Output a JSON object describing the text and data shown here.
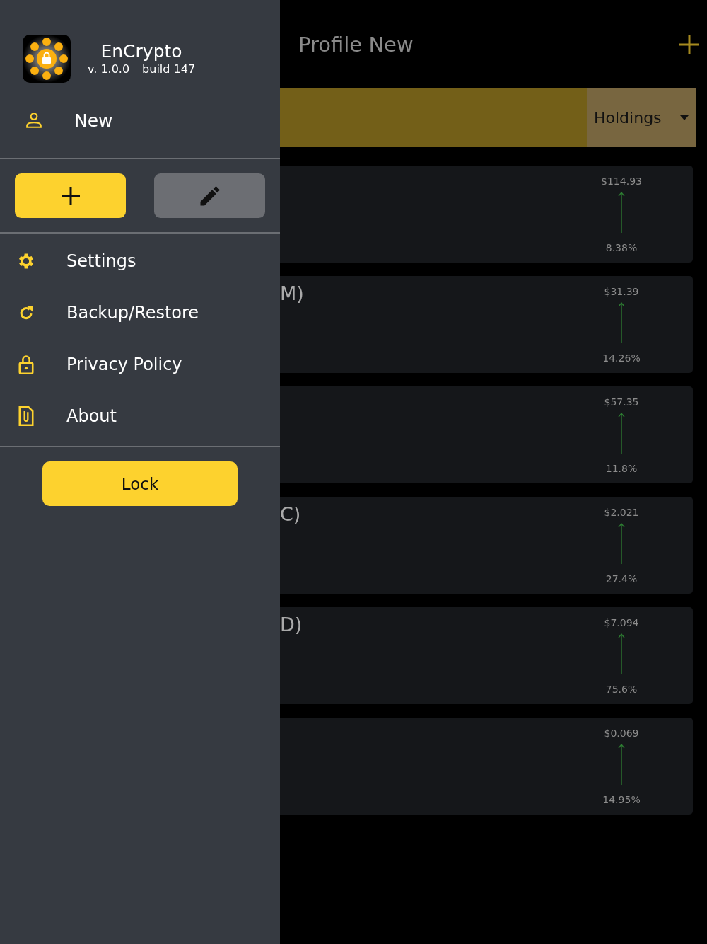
{
  "drawer": {
    "app_name": "EnCrypto",
    "version": "v. 1.0.0",
    "build": "build 147",
    "profile": {
      "label": "New"
    },
    "action_buttons": [
      {
        "kind": "add"
      },
      {
        "kind": "edit"
      }
    ],
    "menu": [
      {
        "kind": "settings",
        "label": "Settings"
      },
      {
        "kind": "backup",
        "label": "Backup/Restore"
      },
      {
        "kind": "privacy",
        "label": "Privacy Policy"
      },
      {
        "kind": "about",
        "label": "About"
      }
    ],
    "lock_button": "Lock"
  },
  "main": {
    "title": "Profile New",
    "sort": "Holdings",
    "cards": [
      {
        "price": "$114.93",
        "change": "8.38%",
        "kind": "up"
      },
      {
        "name": "M)",
        "price": "$31.39",
        "change": "14.26%",
        "kind": "up"
      },
      {
        "price": "$57.35",
        "change": "11.8%",
        "kind": "up"
      },
      {
        "name": "C)",
        "price": "$2.021",
        "change": "27.4%",
        "kind": "up"
      },
      {
        "name": "D)",
        "price": "$7.094",
        "change": "75.6%",
        "kind": "up"
      },
      {
        "price": "$0.069",
        "change": "14.95%",
        "kind": "up"
      }
    ]
  }
}
